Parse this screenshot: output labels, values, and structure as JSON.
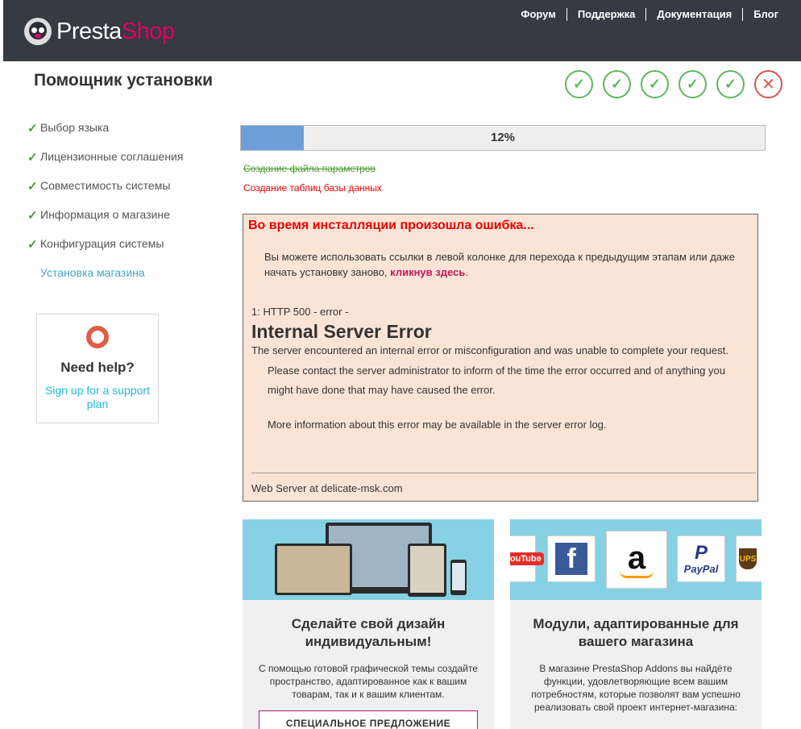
{
  "header": {
    "logo_part1": "Presta",
    "logo_part2": "Shop",
    "nav": [
      "Форум",
      "Поддержка",
      "Документация",
      "Блог"
    ]
  },
  "page": {
    "title": "Помощник установки"
  },
  "steps_status": [
    "done",
    "done",
    "done",
    "done",
    "done",
    "error"
  ],
  "sidebar": {
    "items": [
      {
        "label": "Выбор языка",
        "done": true
      },
      {
        "label": "Лицензионные соглашения",
        "done": true
      },
      {
        "label": "Совместимость системы",
        "done": true
      },
      {
        "label": "Информация о магазине",
        "done": true
      },
      {
        "label": "Конфигурация системы",
        "done": true
      },
      {
        "label": "Установка магазина",
        "done": false
      }
    ]
  },
  "help": {
    "title": "Need help?",
    "link": "Sign up for a support plan"
  },
  "progress": {
    "percent": 12,
    "label": "12%"
  },
  "tasks": {
    "done": "Создание файла параметров",
    "failed": "Создание таблиц базы данных"
  },
  "error": {
    "title": "Во время инсталляции произошла ошибка...",
    "message": "Вы можете использовать ссылки в левой колонке для перехода к предыдущим этапам или даже начать установку заново, ",
    "link": "кликнув здесь",
    "message_end": ".",
    "code": "1: HTTP 500 - error -",
    "heading": "Internal Server Error",
    "p1": "The server encountered an internal error or misconfiguration and was unable to complete your request.",
    "p2": "Please contact the server administrator to inform of the time the error occurred and of anything you might have done that may have caused the error.",
    "p3": "More information about this error may be available in the server error log.",
    "server": "Web Server at delicate-msk.com"
  },
  "promos": [
    {
      "title": "Сделайте свой дизайн индивидуальным!",
      "text": "С помощью готовой графической темы создайте пространство, адаптированное как к вашим товарам, так и к вашим клиентам.",
      "button": "СПЕЦИАЛЬНОЕ ПРЕДЛОЖЕНИЕ"
    },
    {
      "title": "Модули, адаптированные для вашего магазина",
      "text": "В магазине PrestaShop Addons вы найдёте функции, удовлетворяющие всем вашим потребностям, которые позволят вам успешно реализовать свой проект интернет-магазина:",
      "logos": [
        "YouTube",
        "Facebook",
        "Amazon",
        "PayPal",
        "UPS"
      ]
    }
  ],
  "colors": {
    "header_bg": "#363a41",
    "brand_pink": "#df0067",
    "success": "#5cb85c",
    "danger": "#d9534f",
    "progress_fill": "#6d9fd8",
    "link": "#25b9d7"
  }
}
